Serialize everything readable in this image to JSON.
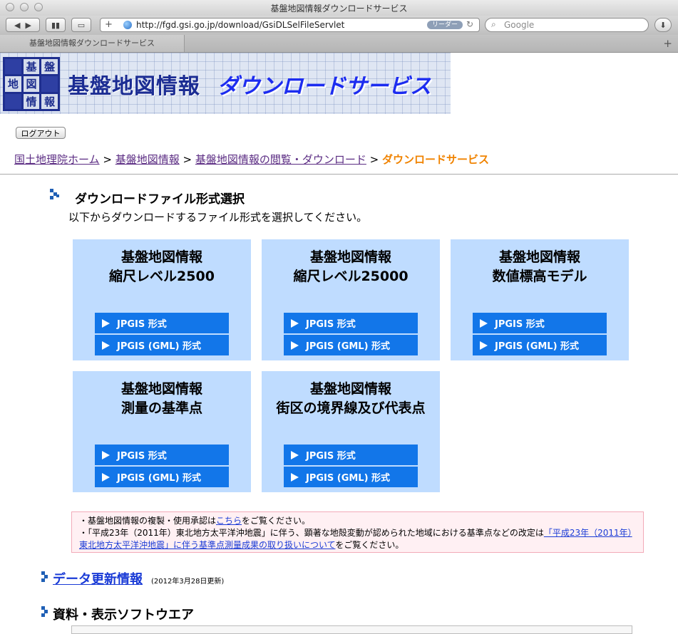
{
  "window": {
    "title": "基盤地図情報ダウンロードサービス"
  },
  "toolbar": {
    "url": "http://fgd.gsi.go.jp/download/GsiDLSelFileServlet",
    "reader_label": "リーダー",
    "search_placeholder": "Google",
    "add_label": "+"
  },
  "tab": {
    "title": "基盤地図情報ダウンロードサービス"
  },
  "banner": {
    "logo_chars": [
      "基",
      "盤",
      "地",
      "図",
      "情",
      "報"
    ],
    "title": "基盤地図情報",
    "subtitle": "ダウンロードサービス"
  },
  "logout_label": "ログアウト",
  "breadcrumb": {
    "home": "国土地理院ホーム",
    "item2": "基盤地図情報",
    "item3": "基盤地図情報の閲覧・ダウンロード",
    "current": "ダウンロードサービス",
    "sep": ">"
  },
  "section": {
    "title": "ダウンロードファイル形式選択",
    "desc": "以下からダウンロードするファイル形式を選択してください。"
  },
  "cards": [
    {
      "title1": "基盤地図情報",
      "title2": "縮尺レベル2500",
      "btn1": "JPGIS 形式",
      "btn2": "JPGIS (GML) 形式"
    },
    {
      "title1": "基盤地図情報",
      "title2": "縮尺レベル25000",
      "btn1": "JPGIS 形式",
      "btn2": "JPGIS (GML) 形式"
    },
    {
      "title1": "基盤地図情報",
      "title2": "数値標高モデル",
      "btn1": "JPGIS 形式",
      "btn2": "JPGIS (GML) 形式"
    },
    {
      "title1": "基盤地図情報",
      "title2": "測量の基準点",
      "btn1": "JPGIS 形式",
      "btn2": "JPGIS (GML) 形式"
    },
    {
      "title1": "基盤地図情報",
      "title2": "街区の境界線及び代表点",
      "btn1": "JPGIS 形式",
      "btn2": "JPGIS (GML) 形式"
    }
  ],
  "notice": {
    "line1_pre": "・基盤地図情報の複製・使用承認は",
    "line1_link": "こちら",
    "line1_post": "をご覧ください。",
    "line2_pre": "・「平成23年（2011年）東北地方太平洋沖地震」に伴う、顕著な地殻変動が認められた地域における基準点などの改定は",
    "line2_link": "「平成23年（2011年）東北地方太平洋沖地震」に伴う基準点測量成果の取り扱いについて",
    "line2_post": "をご覧ください。"
  },
  "update": {
    "link": "データ更新情報",
    "date": "(2012年3月28日更新)"
  },
  "software": {
    "title": "資料・表示ソフトウエア"
  },
  "colors": {
    "card_bg": "#bfdcff",
    "button_bg": "#1276e9",
    "breadcrumb_current": "#f08300"
  }
}
